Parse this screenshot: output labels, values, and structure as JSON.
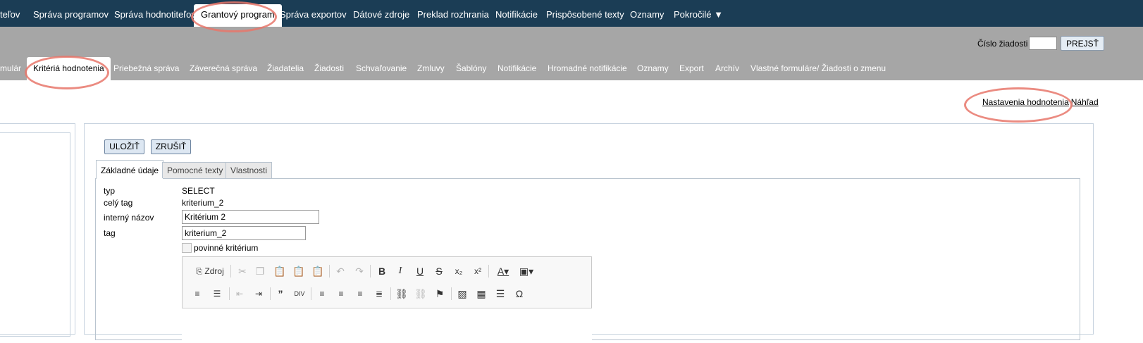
{
  "top_nav": [
    "teľov",
    "Správa programov",
    "Správa hodnotiteľov",
    "Grantový program",
    "Správa exportov",
    "Dátové zdroje",
    "Preklad rozhrania",
    "Notifikácie",
    "Prispôsobené texty",
    "Oznamy",
    "Pokročilé ▼"
  ],
  "search": {
    "label": "Číslo žiadosti",
    "value": "",
    "button": "PREJSŤ"
  },
  "sub_nav": [
    "mulár",
    "Kritériá hodnotenia",
    "Priebežná správa",
    "Záverečná správa",
    "Žiadatelia",
    "Žiadosti",
    "Schvaľovanie",
    "Zmluvy",
    "Šablóny",
    "Notifikácie",
    "Hromadné notifikácie",
    "Oznamy",
    "Export",
    "Archív",
    "Vlastné formuláre/ Žiadosti o zmenu"
  ],
  "right_links": {
    "settings": "Nastavenia hodnotenia",
    "preview": "Náhľad"
  },
  "actions": {
    "save": "ULOŽIŤ",
    "cancel": "ZRUŠIŤ"
  },
  "tabs": [
    "Základné údaje",
    "Pomocné texty",
    "Vlastnosti"
  ],
  "form": {
    "type_label": "typ",
    "type_value": "SELECT",
    "fulltag_label": "celý tag",
    "fulltag_value": "kriterium_2",
    "name_label": "interný názov",
    "name_value": "Kritérium 2",
    "tag_label": "tag",
    "tag_value": "kriterium_2",
    "required_label": "povinné kritérium"
  },
  "editor": {
    "source_label": "Zdroj",
    "toolbar_row1": [
      "source-icon",
      "cut-icon",
      "copy-icon",
      "paste-icon",
      "paste-text-icon",
      "paste-word-icon",
      "undo-icon",
      "redo-icon",
      "bold-icon",
      "italic-icon",
      "underline-icon",
      "strike-icon",
      "subscript-icon",
      "superscript-icon",
      "text-color-icon",
      "bg-color-icon"
    ],
    "toolbar_row2": [
      "numbered-list-icon",
      "bulleted-list-icon",
      "outdent-icon",
      "indent-icon",
      "blockquote-icon",
      "div-icon",
      "align-left-icon",
      "align-center-icon",
      "align-right-icon",
      "justify-icon",
      "link-icon",
      "unlink-icon",
      "anchor-icon",
      "image-icon",
      "table-icon",
      "horizontal-line-icon",
      "special-char-icon"
    ]
  },
  "colors": {
    "top_nav_bg": "#1b3d55",
    "sub_nav_bg": "#a6a6a6",
    "annotation": "#e8776b"
  }
}
